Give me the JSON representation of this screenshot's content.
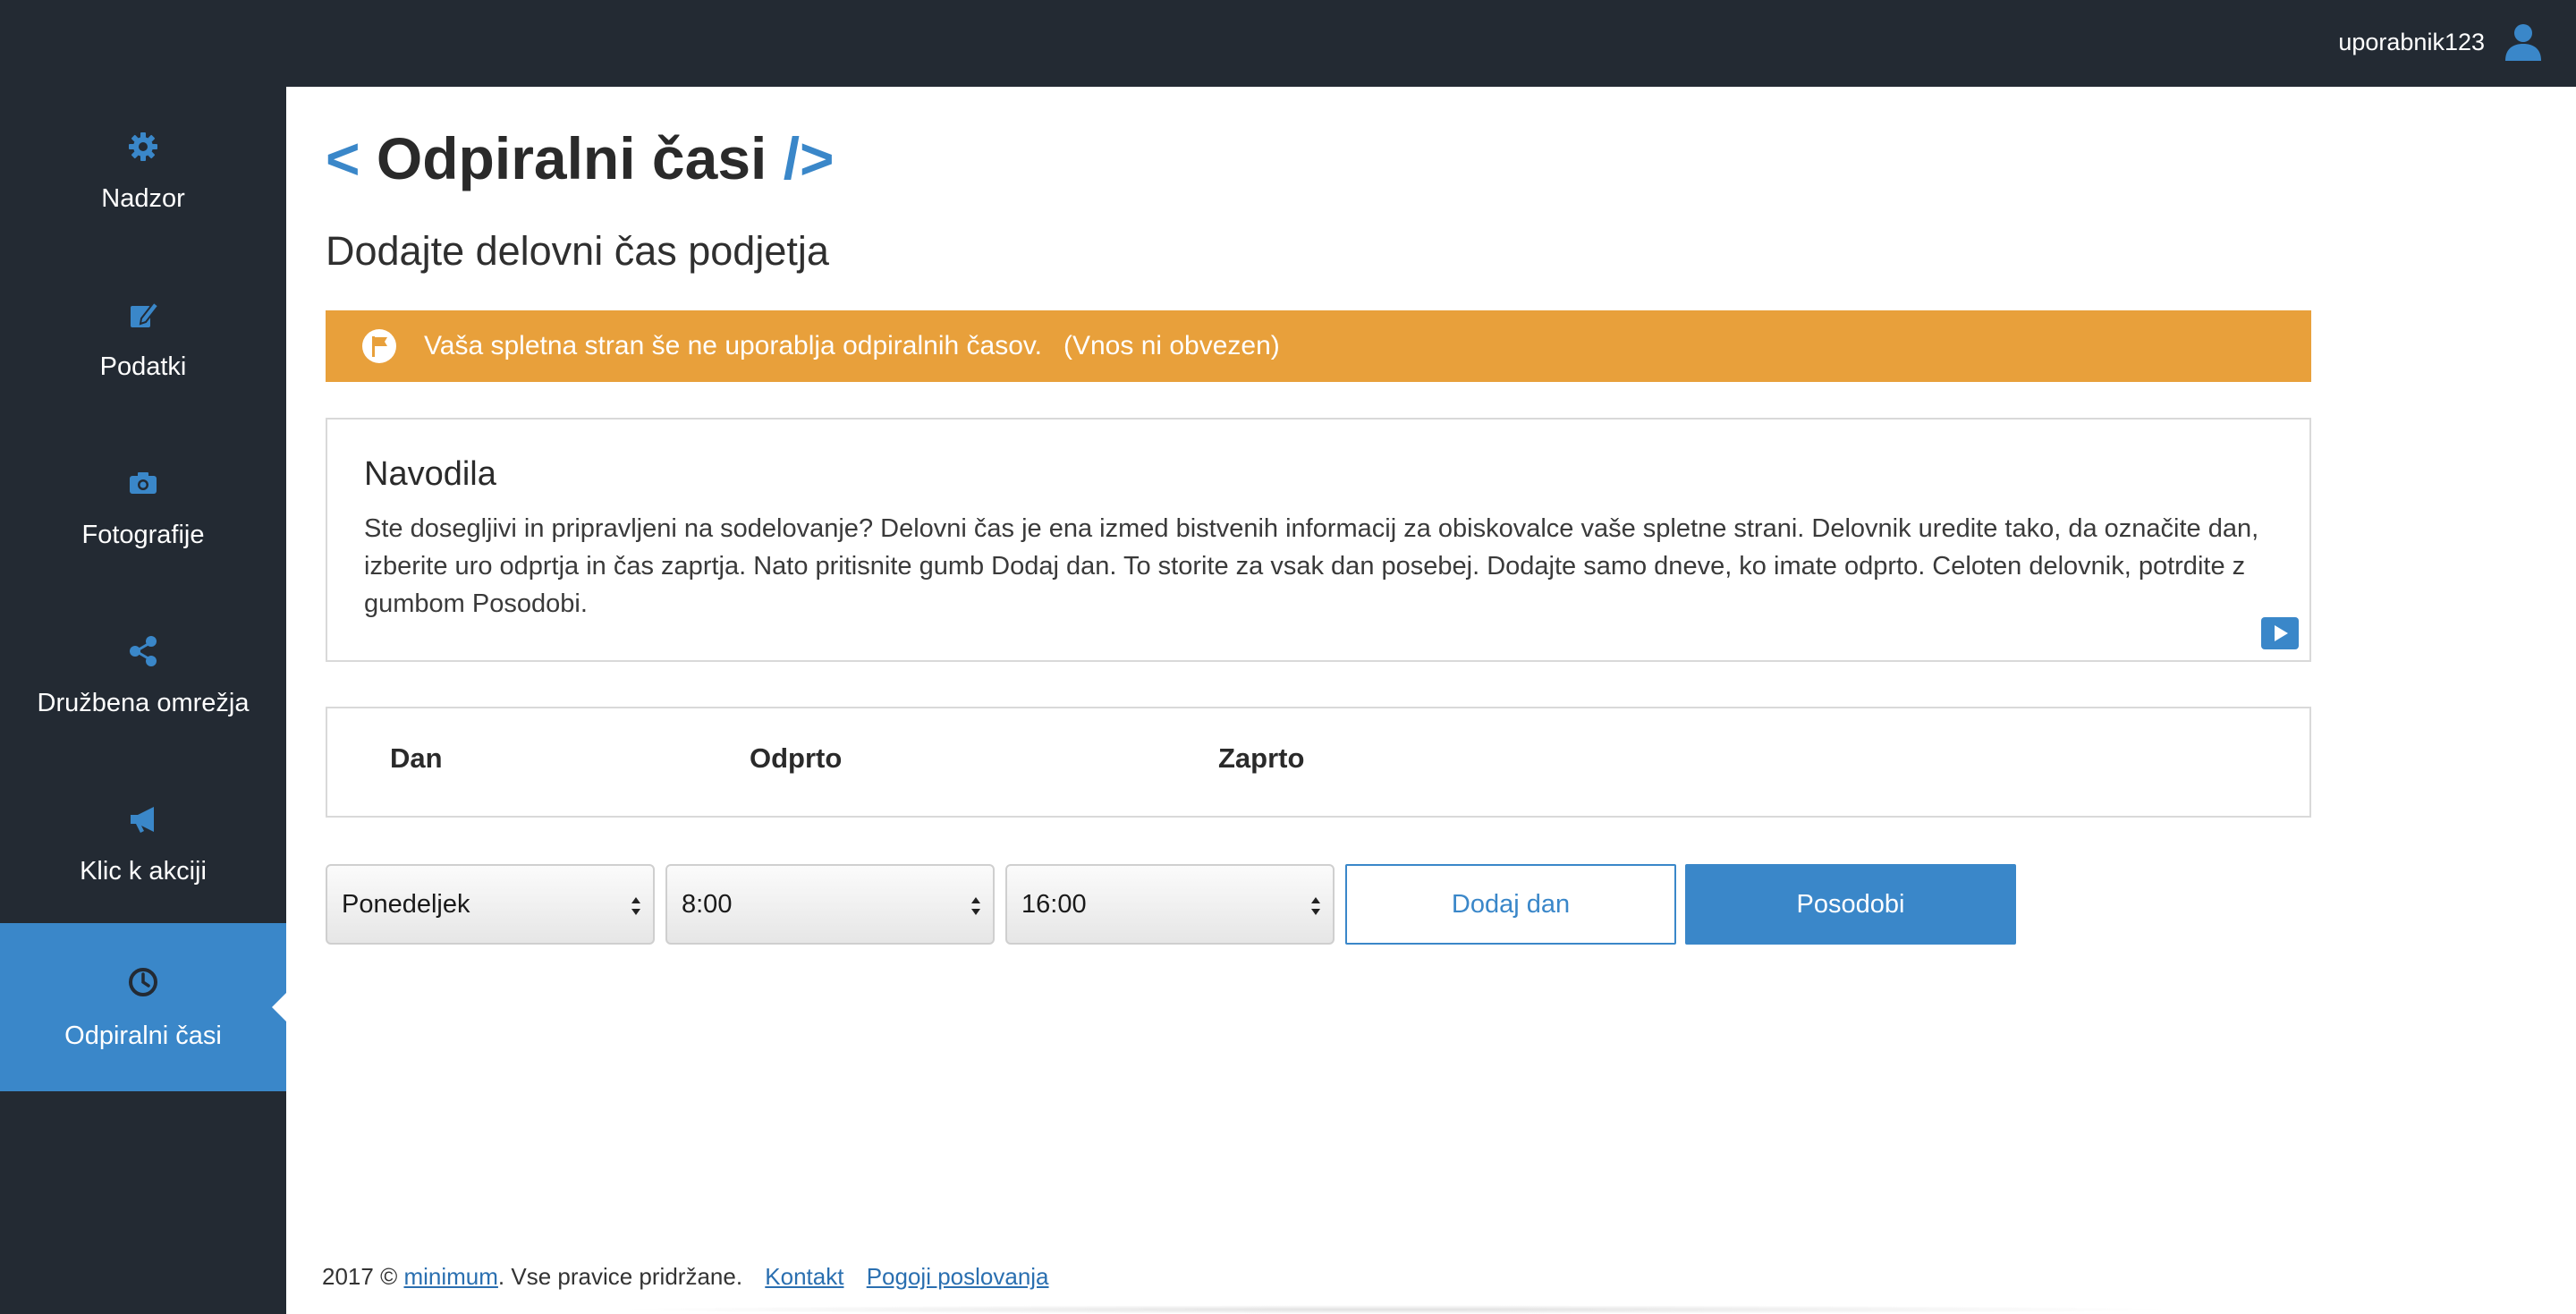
{
  "header": {
    "username": "uporabnik123",
    "user_icon": "user-icon"
  },
  "sidebar": {
    "items": [
      {
        "label": "Nadzor",
        "icon": "gear-icon",
        "active": false
      },
      {
        "label": "Podatki",
        "icon": "edit-icon",
        "active": false
      },
      {
        "label": "Fotografije",
        "icon": "camera-icon",
        "active": false
      },
      {
        "label": "Družbena omrežja",
        "icon": "share-icon",
        "active": false
      },
      {
        "label": "Klic k akciji",
        "icon": "megaphone-icon",
        "active": false
      },
      {
        "label": "Odpiralni časi",
        "icon": "clock-icon",
        "active": true
      }
    ]
  },
  "page": {
    "title_open": "<",
    "title": "Odpiralni časi",
    "title_close": "/>",
    "subtitle": "Dodajte delovni čas podjetja"
  },
  "alert": {
    "icon": "flag-icon",
    "message": "Vaša spletna stran še ne uporablja odpiralnih časov.",
    "note": "(Vnos ni obvezen)",
    "color": "#e8a03b"
  },
  "instructions": {
    "heading": "Navodila",
    "text": "Ste dosegljivi in pripravljeni na sodelovanje? Delovni čas je ena izmed bistvenih informacij za obiskovalce vaše spletne strani. Delovnik uredite tako, da označite dan, izberite uro odprtja in čas zaprtja. Nato pritisnite gumb Dodaj dan. To storite za vsak dan posebej. Dodajte samo dneve, ko imate odprto. Celoten delovnik, potrdite z gumbom Posodobi.",
    "video_icon": "play-icon"
  },
  "table": {
    "columns": [
      "Dan",
      "Odprto",
      "Zaprto"
    ],
    "rows": []
  },
  "form": {
    "day_select": "Ponedeljek",
    "open_select": "8:00",
    "close_select": "16:00",
    "add_button": "Dodaj dan",
    "update_button": "Posodobi"
  },
  "footer": {
    "prefix": "2017 ©",
    "brand_link": "minimum",
    "rights": ". Vse pravice pridržane.",
    "contact_link": "Kontakt",
    "terms_link": "Pogoji poslovanja"
  },
  "colors": {
    "accent": "#3a87c9",
    "dark": "#232a33",
    "warning": "#e8a03b"
  }
}
